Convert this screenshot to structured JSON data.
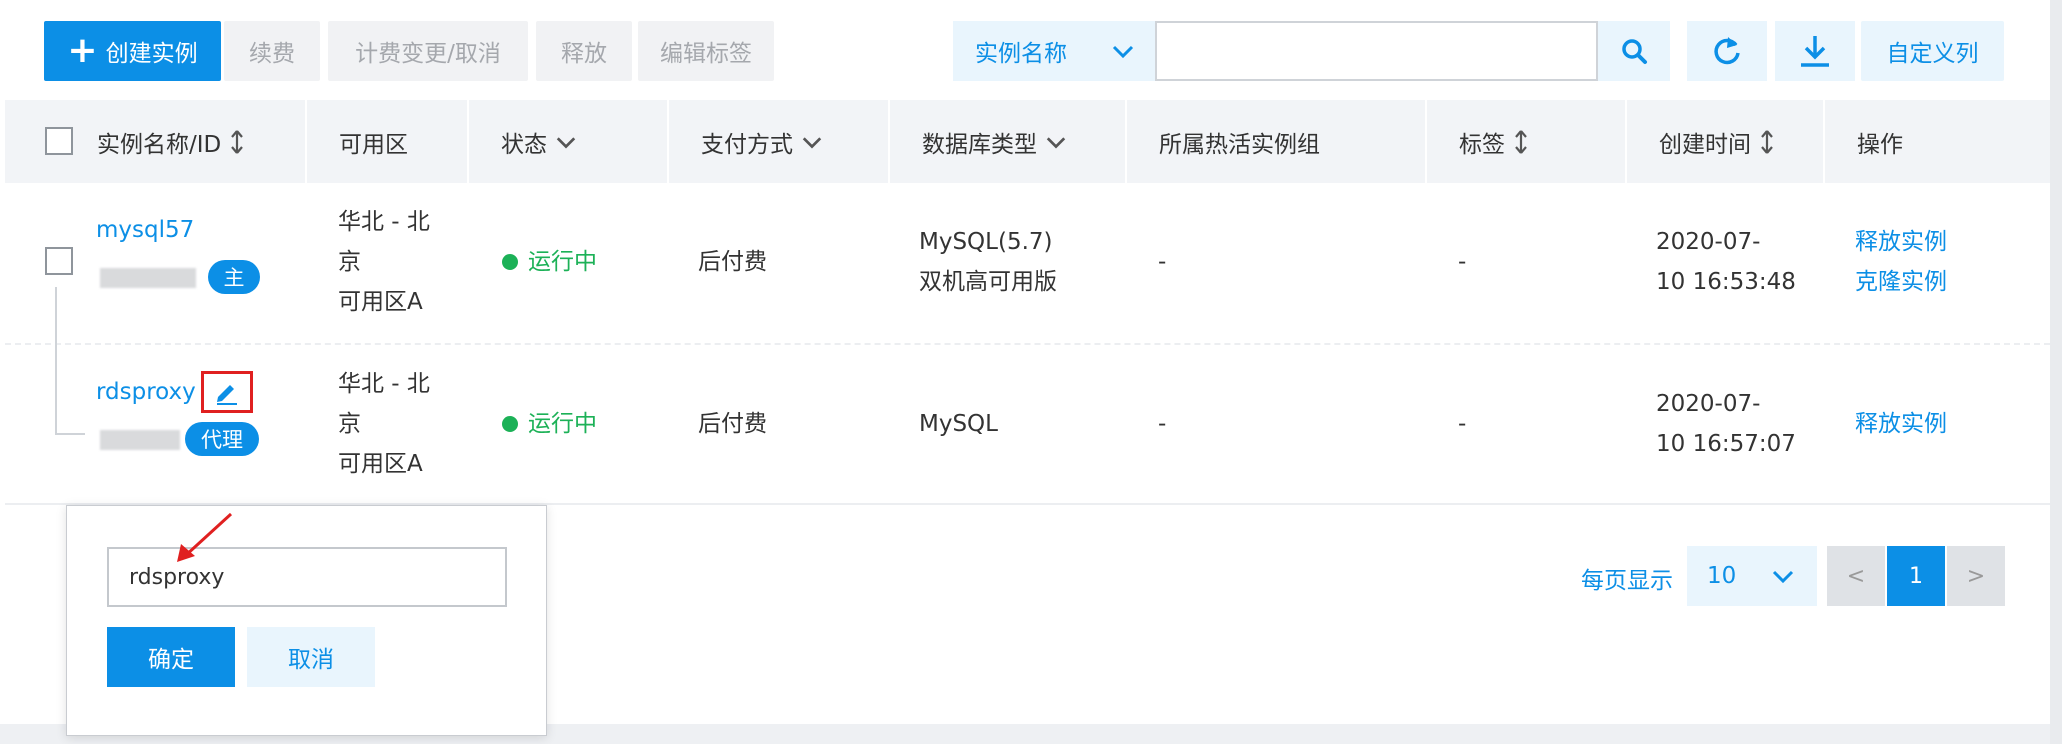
{
  "toolbar": {
    "create_label": "创建实例",
    "renew_label": "续费",
    "billing_label": "计费变更/取消",
    "release_label": "释放",
    "edit_tags_label": "编辑标签",
    "search_field_label": "实例名称",
    "search_value": "",
    "custom_columns_label": "自定义列"
  },
  "table": {
    "headers": {
      "name": "实例名称/ID",
      "zone": "可用区",
      "status": "状态",
      "payment": "支付方式",
      "db_type": "数据库类型",
      "hot_group": "所属热活实例组",
      "tags": "标签",
      "created": "创建时间",
      "actions": "操作"
    },
    "rows": [
      {
        "name": "mysql57",
        "role_badge": "主",
        "zone_line1": "华北 - 北",
        "zone_line2": "京",
        "zone_line3": "可用区A",
        "status": "运行中",
        "payment": "后付费",
        "db_type_line1": "MySQL(5.7)",
        "db_type_line2": "双机高可用版",
        "hot_group": "-",
        "tags": "-",
        "created_line1": "2020-07-",
        "created_line2": "10 16:53:48",
        "action1": "释放实例",
        "action2": "克隆实例"
      },
      {
        "name": "rdsproxy",
        "role_badge": "代理",
        "zone_line1": "华北 - 北",
        "zone_line2": "京",
        "zone_line3": "可用区A",
        "status": "运行中",
        "payment": "后付费",
        "db_type_line1": "MySQL",
        "hot_group": "-",
        "tags": "-",
        "created_line1": "2020-07-",
        "created_line2": "10 16:57:07",
        "action1": "释放实例"
      }
    ]
  },
  "pagination": {
    "per_page_label": "每页显示",
    "per_page_value": "10",
    "prev": "<",
    "current_page": "1",
    "next": ">"
  },
  "rename_popup": {
    "input_value": "rdsproxy",
    "confirm_label": "确定",
    "cancel_label": "取消"
  },
  "colors": {
    "primary": "#0c8fe6",
    "running": "#1cb157",
    "highlight": "#e02020"
  }
}
